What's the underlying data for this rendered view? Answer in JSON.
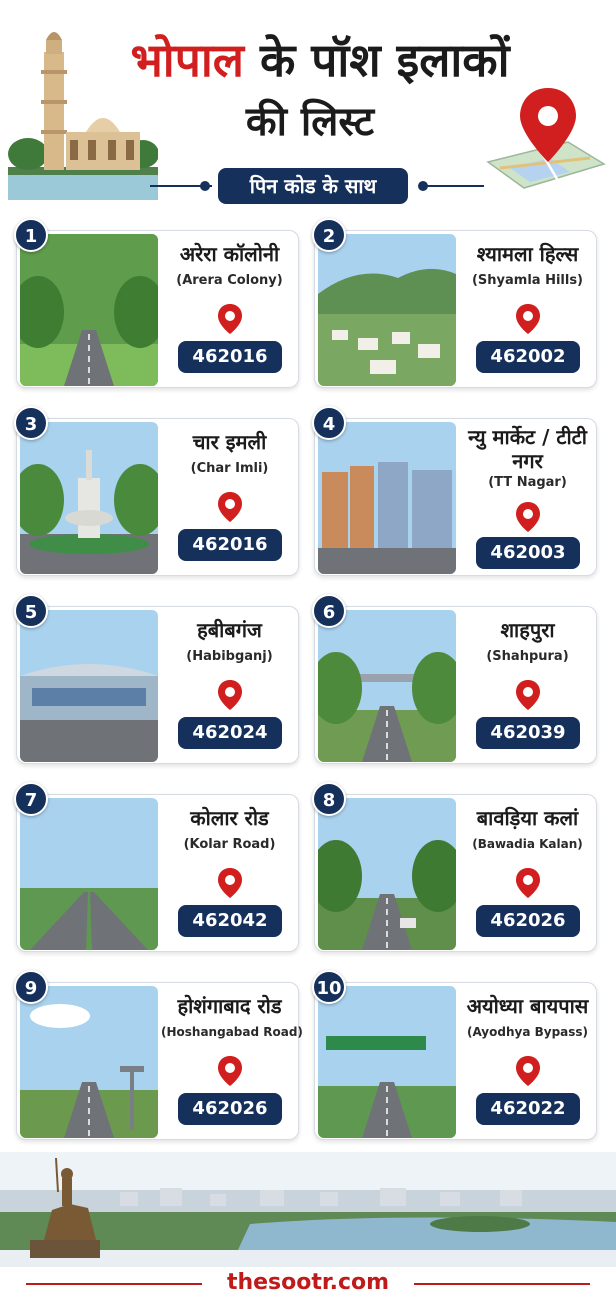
{
  "header": {
    "title_part1": "भोपाल",
    "title_part2": "के पॉश इलाकों",
    "title_line2": "की लिस्ट",
    "subtitle": "पिन कोड के साथ"
  },
  "areas": [
    {
      "num": "1",
      "name_hi": "अरेरा कॉलोनी",
      "name_en": "(Arera Colony)",
      "pin": "462016"
    },
    {
      "num": "2",
      "name_hi": "श्यामला हिल्स",
      "name_en": "(Shyamla Hills)",
      "pin": "462002"
    },
    {
      "num": "3",
      "name_hi": "चार इमली",
      "name_en": "(Char Imli)",
      "pin": "462016"
    },
    {
      "num": "4",
      "name_hi": "न्यु मार्केट / टीटी नगर",
      "name_en": "(TT Nagar)",
      "pin": "462003"
    },
    {
      "num": "5",
      "name_hi": "हबीबगंज",
      "name_en": "(Habibganj)",
      "pin": "462024"
    },
    {
      "num": "6",
      "name_hi": "शाहपुरा",
      "name_en": "(Shahpura)",
      "pin": "462039"
    },
    {
      "num": "7",
      "name_hi": "कोलार रोड",
      "name_en": "(Kolar Road)",
      "pin": "462042"
    },
    {
      "num": "8",
      "name_hi": "बावड़िया कलां",
      "name_en": "(Bawadia Kalan)",
      "pin": "462026"
    },
    {
      "num": "9",
      "name_hi": "होशंगाबाद रोड",
      "name_en": "(Hoshangabad Road)",
      "pin": "462026"
    },
    {
      "num": "10",
      "name_hi": "अयोध्या बायपास",
      "name_en": "(Ayodhya Bypass)",
      "pin": "462022"
    }
  ],
  "icons": [
    "location-pin-icon",
    "map-illustration",
    "minaret-illustration",
    "statue-illustration"
  ],
  "colors": {
    "accent_red": "#d11f1f",
    "navy": "#16305c"
  },
  "footer": {
    "brand": "thesootr.com"
  }
}
